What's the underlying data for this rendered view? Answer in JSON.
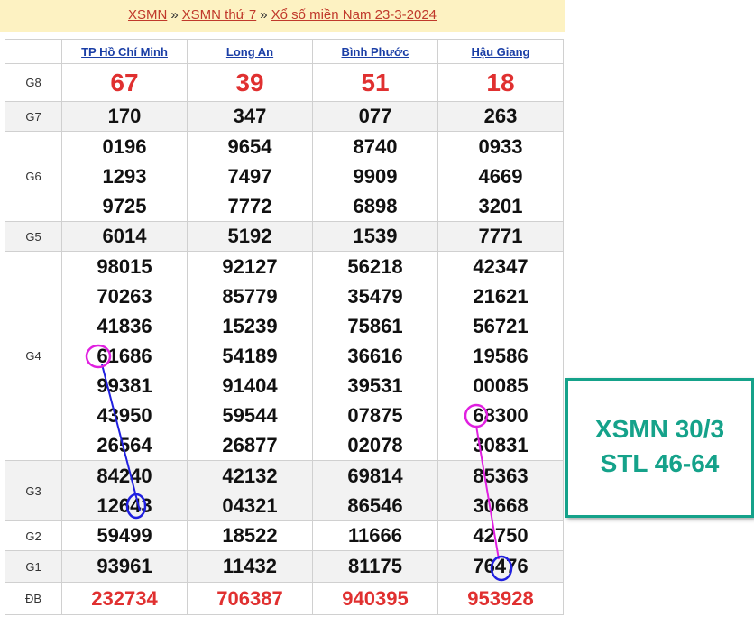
{
  "header": {
    "crumb1": "XSMN",
    "sep1": "»",
    "crumb2": "XSMN thứ 7",
    "sep2": "»",
    "crumb3": "Xổ số miền Nam 23-3-2024"
  },
  "provinces": [
    "TP Hồ Chí Minh",
    "Long An",
    "Bình Phước",
    "Hậu Giang"
  ],
  "labels": {
    "g8": "G8",
    "g7": "G7",
    "g6": "G6",
    "g5": "G5",
    "g4": "G4",
    "g3": "G3",
    "g2": "G2",
    "g1": "G1",
    "db": "ĐB"
  },
  "results": {
    "g8": [
      "67",
      "39",
      "51",
      "18"
    ],
    "g7": [
      "170",
      "347",
      "077",
      "263"
    ],
    "g6": [
      [
        "0196",
        "1293",
        "9725"
      ],
      [
        "9654",
        "7497",
        "7772"
      ],
      [
        "8740",
        "9909",
        "6898"
      ],
      [
        "0933",
        "4669",
        "3201"
      ]
    ],
    "g5": [
      "6014",
      "5192",
      "1539",
      "7771"
    ],
    "g4": [
      [
        "98015",
        "70263",
        "41836",
        "61686",
        "99381",
        "43950",
        "26564"
      ],
      [
        "92127",
        "85779",
        "15239",
        "54189",
        "91404",
        "59544",
        "26877"
      ],
      [
        "56218",
        "35479",
        "75861",
        "36616",
        "39531",
        "07875",
        "02078"
      ],
      [
        "42347",
        "21621",
        "56721",
        "19586",
        "00085",
        "68300",
        "30831"
      ]
    ],
    "g3": [
      [
        "84240",
        "12643"
      ],
      [
        "42132",
        "04321"
      ],
      [
        "69814",
        "86546"
      ],
      [
        "85363",
        "30668"
      ]
    ],
    "g2": [
      "59499",
      "18522",
      "11666",
      "42750"
    ],
    "g1": [
      "93961",
      "11432",
      "81175",
      "76476"
    ],
    "db": [
      "232734",
      "706387",
      "940395",
      "953928"
    ]
  },
  "callout": {
    "line1": "XSMN 30/3",
    "line2": "STL 46-64"
  },
  "colors": {
    "accent": "#15a28a",
    "prize": "#e03030",
    "link": "#1a3ea6",
    "header_bg": "#fdf2c2",
    "mark_magenta": "#e020e0",
    "mark_blue": "#2020e0"
  }
}
